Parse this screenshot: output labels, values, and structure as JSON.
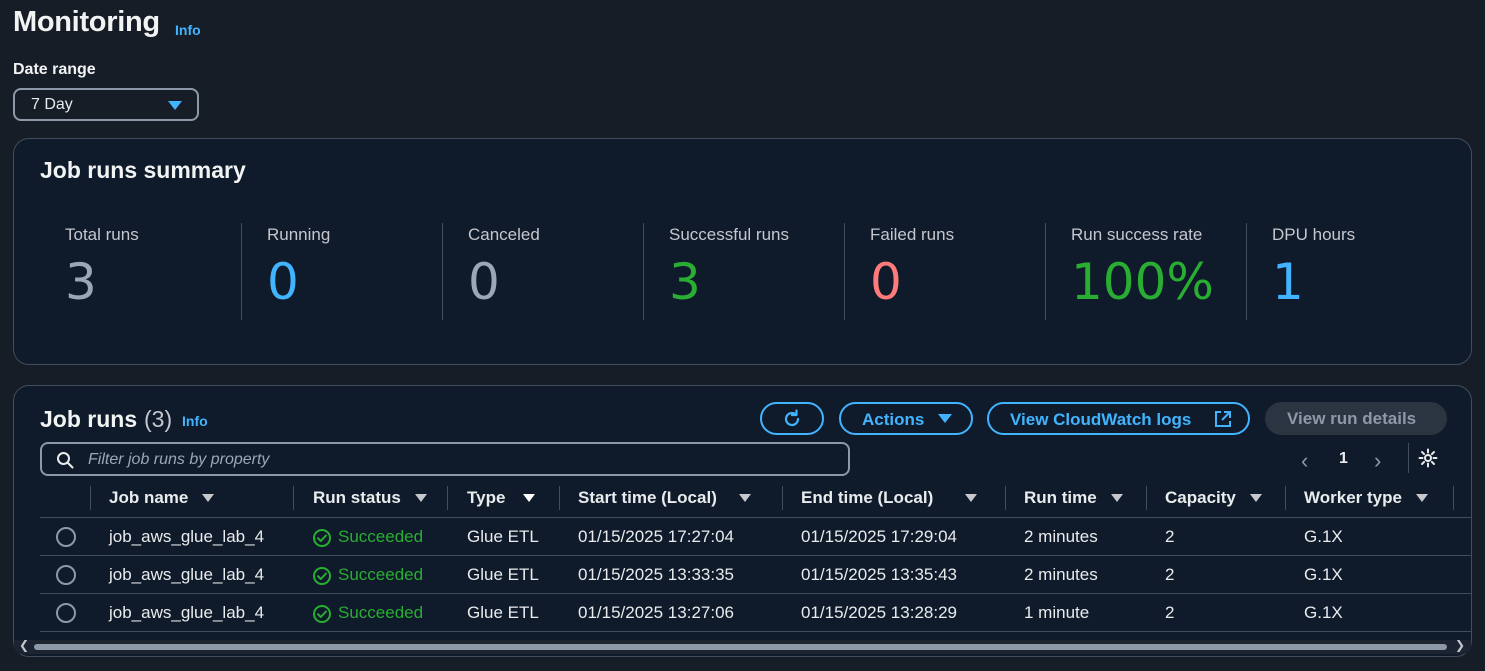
{
  "page": {
    "title": "Monitoring",
    "info": "Info"
  },
  "date_range": {
    "label": "Date range",
    "value": "7 Day"
  },
  "summary": {
    "title": "Job runs summary",
    "metrics": [
      {
        "label": "Total runs",
        "value": "3",
        "color": "#9ba7b6"
      },
      {
        "label": "Running",
        "value": "0",
        "color": "#42b4ff"
      },
      {
        "label": "Canceled",
        "value": "0",
        "color": "#9ba7b6"
      },
      {
        "label": "Successful runs",
        "value": "3",
        "color": "#29ad32"
      },
      {
        "label": "Failed runs",
        "value": "0",
        "color": "#ff7a7a"
      },
      {
        "label": "Run success rate",
        "value": "100%",
        "color": "#29ad32"
      },
      {
        "label": "DPU hours",
        "value": "1",
        "color": "#42b4ff"
      }
    ]
  },
  "job_runs": {
    "title": "Job runs",
    "count": "(3)",
    "info": "Info",
    "actions_label": "Actions",
    "cloudwatch_label": "View CloudWatch logs",
    "details_label": "View run details",
    "filter_placeholder": "Filter job runs by property",
    "page": "1",
    "columns": [
      "Job name",
      "Run status",
      "Type",
      "Start time (Local)",
      "End time (Local)",
      "Run time",
      "Capacity",
      "Worker type"
    ],
    "rows": [
      {
        "job_name": "job_aws_glue_lab_4",
        "status": "Succeeded",
        "type": "Glue ETL",
        "start": "01/15/2025 17:27:04",
        "end": "01/15/2025 17:29:04",
        "run_time": "2 minutes",
        "capacity": "2",
        "worker": "G.1X"
      },
      {
        "job_name": "job_aws_glue_lab_4",
        "status": "Succeeded",
        "type": "Glue ETL",
        "start": "01/15/2025 13:33:35",
        "end": "01/15/2025 13:35:43",
        "run_time": "2 minutes",
        "capacity": "2",
        "worker": "G.1X"
      },
      {
        "job_name": "job_aws_glue_lab_4",
        "status": "Succeeded",
        "type": "Glue ETL",
        "start": "01/15/2025 13:27:06",
        "end": "01/15/2025 13:28:29",
        "run_time": "1 minute",
        "capacity": "2",
        "worker": "G.1X"
      }
    ]
  },
  "icons": {
    "refresh": "refresh-icon",
    "external": "external-link-icon",
    "search": "search-icon",
    "settings": "gear-icon",
    "success": "check-circle-icon"
  },
  "colors": {
    "accent": "#42b4ff",
    "success": "#29ad32",
    "error": "#ff7a7a",
    "background": "#161d26",
    "panel": "#0f1b2a"
  }
}
